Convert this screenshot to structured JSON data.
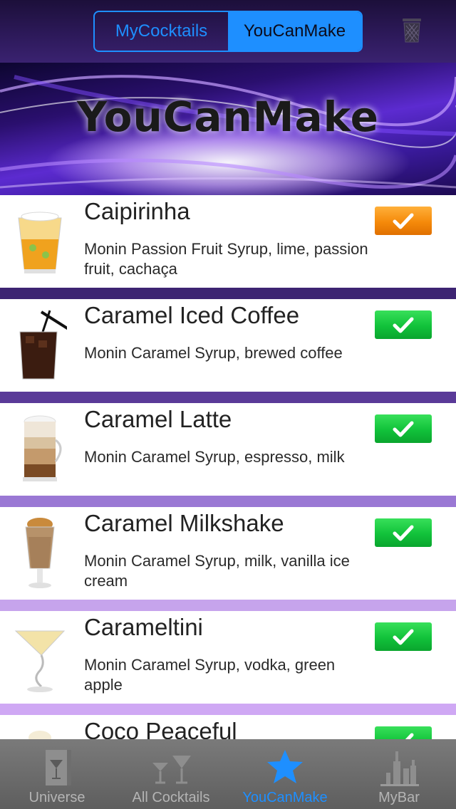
{
  "header": {
    "segments": [
      {
        "label": "MyCocktails",
        "active": false
      },
      {
        "label": "YouCanMake",
        "active": true
      }
    ],
    "trash_icon": "trash-icon"
  },
  "banner": {
    "title": "YouCanMake"
  },
  "cocktails": [
    {
      "name": "Caipirinha",
      "ingredients": "Monin Passion Fruit Syrup, lime, passion fruit, cachaça",
      "check_color": "#f58a0a",
      "status": "orange"
    },
    {
      "name": "Caramel Iced Coffee",
      "ingredients": "Monin Caramel Syrup, brewed coffee",
      "check_color": "#11c23a",
      "status": "green"
    },
    {
      "name": "Caramel Latte",
      "ingredients": "Monin Caramel Syrup, espresso, milk",
      "check_color": "#11c23a",
      "status": "green"
    },
    {
      "name": "Caramel Milkshake",
      "ingredients": "Monin Caramel Syrup, milk, vanilla ice cream",
      "check_color": "#11c23a",
      "status": "green"
    },
    {
      "name": "Carameltini",
      "ingredients": "Monin Caramel Syrup, vodka, green apple",
      "check_color": "#11c23a",
      "status": "green"
    },
    {
      "name": "Coco Peaceful",
      "ingredients": "",
      "check_color": "#11c23a",
      "status": "green"
    }
  ],
  "separators": [
    "#3d2472",
    "#5a3a98",
    "#9a78d4",
    "#c6a4ec",
    "#cfa8f4"
  ],
  "tabs": [
    {
      "label": "Universe",
      "icon": "universe-icon",
      "active": false
    },
    {
      "label": "All Cocktails",
      "icon": "cocktail-glasses-icon",
      "active": false
    },
    {
      "label": "YouCanMake",
      "icon": "star-icon",
      "active": true
    },
    {
      "label": "MyBar",
      "icon": "bar-bottles-icon",
      "active": false
    }
  ],
  "colors": {
    "accent": "#1e8fff",
    "check_green": "#11c23a",
    "check_orange": "#f58a0a"
  }
}
